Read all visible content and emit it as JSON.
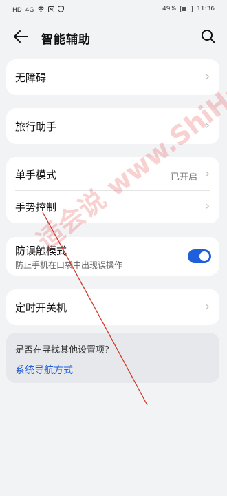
{
  "status_bar": {
    "left_icons": [
      "HD",
      "4G",
      "wifi-icon",
      "nfc-icon",
      "shield-icon"
    ],
    "battery": "49%",
    "time": "11:36"
  },
  "header": {
    "title": "智能辅助"
  },
  "sections": {
    "accessibility": {
      "label": "无障碍"
    },
    "travel_assistant": {
      "label": "旅行助手"
    },
    "one_hand_mode": {
      "label": "单手模式",
      "value": "已开启"
    },
    "gestures": {
      "label": "手势控制"
    },
    "accidental_touch": {
      "label": "防误触模式",
      "desc": "防止手机在口袋中出现误操作",
      "enabled": true
    },
    "scheduled_power": {
      "label": "定时开关机"
    }
  },
  "suggestion": {
    "question": "是否在寻找其他设置项？",
    "link": "系统导航方式"
  },
  "watermark": "适会说 www.ShiHuiShuo.Com",
  "colors": {
    "accent": "#1f5fdc",
    "background": "#f1f3f5",
    "card": "#ffffff"
  }
}
